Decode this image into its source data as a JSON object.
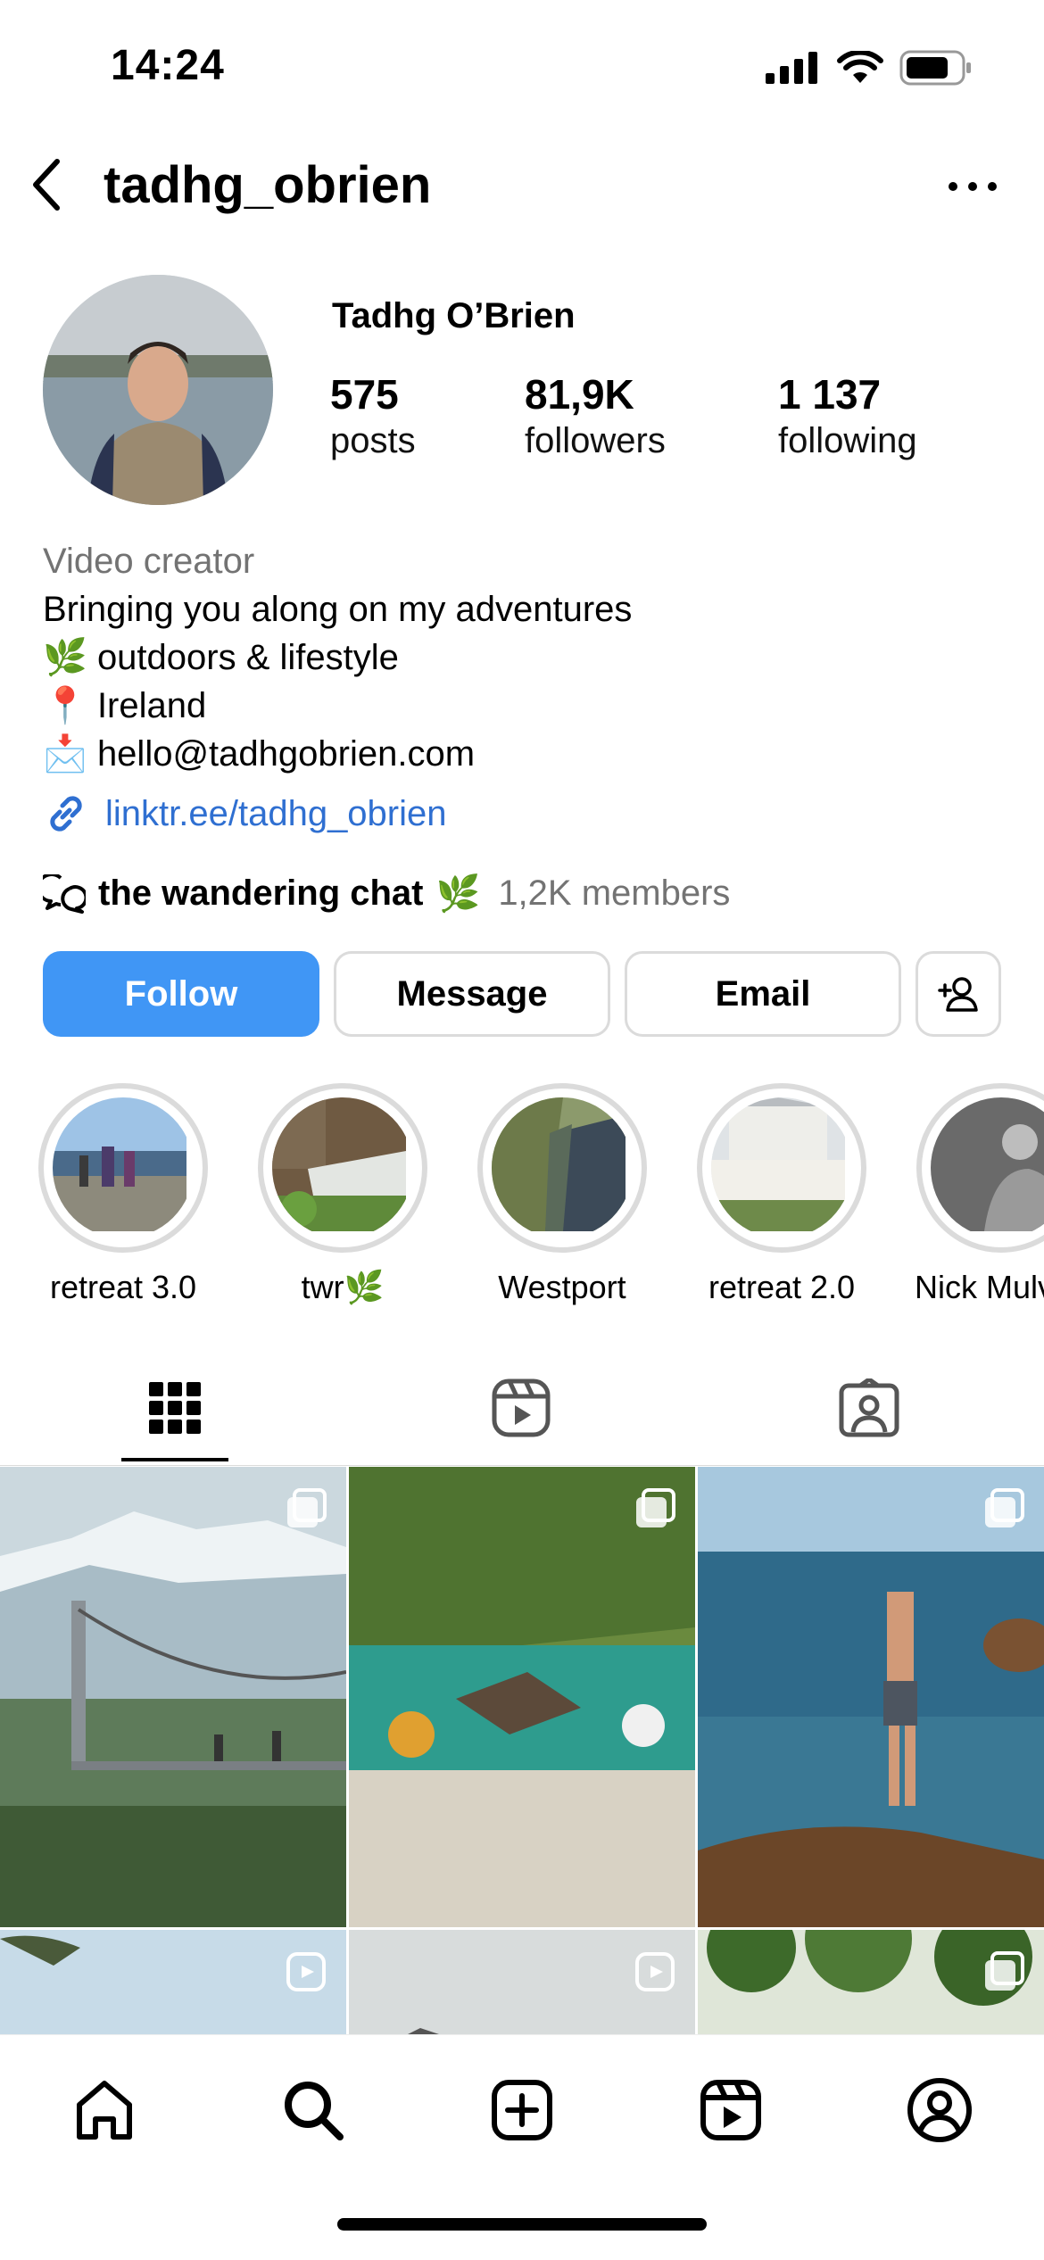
{
  "status_bar": {
    "time": "14:24"
  },
  "header": {
    "username": "tadhg_obrien"
  },
  "profile": {
    "display_name": "Tadhg O’Brien",
    "stats": [
      {
        "value": "575",
        "label": "posts"
      },
      {
        "value": "81,9K",
        "label": "followers"
      },
      {
        "value": "1 137",
        "label": "following"
      }
    ],
    "bio": {
      "category": "Video creator",
      "line1": "Bringing you along on my adventures",
      "line2_emoji": "🌿",
      "line2": "outdoors & lifestyle",
      "line3_emoji": "📍",
      "line3": "Ireland",
      "line4_emoji": "📩",
      "line4": "hello@tadhgobrien.com"
    },
    "link": "linktr.ee/tadhg_obrien",
    "channel": {
      "name": "the wandering chat",
      "emoji": "🌿",
      "members": "1,2K members"
    }
  },
  "actions": {
    "follow": "Follow",
    "message": "Message",
    "email": "Email"
  },
  "highlights": [
    {
      "label": "retreat 3.0"
    },
    {
      "label": "twr🌿"
    },
    {
      "label": "Westport"
    },
    {
      "label": "retreat 2.0"
    },
    {
      "label": "Nick Mulvey"
    }
  ],
  "colors": {
    "accent": "#4096f5",
    "link": "#2f6fd1",
    "secondary_text": "#737373",
    "border": "#dbdbdb"
  },
  "icons": {
    "tabs": [
      "grid-icon",
      "reels-icon",
      "tagged-icon"
    ],
    "nav": [
      "home-icon",
      "search-icon",
      "create-icon",
      "reels-icon",
      "profile-icon"
    ]
  }
}
